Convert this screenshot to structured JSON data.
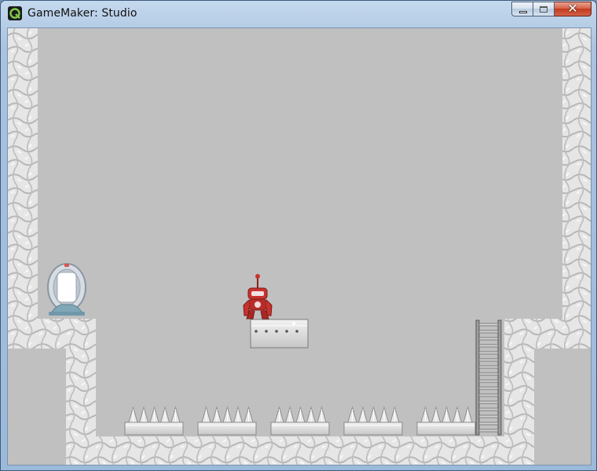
{
  "window": {
    "title": "GameMaker: Studio",
    "icon": "gamemaker-icon",
    "controls": [
      "minimize-icon",
      "maximize-icon",
      "close-icon"
    ]
  },
  "game": {
    "background_color": "#c0c0c0",
    "wall_color": "#e4e4e4",
    "player_color": "#c8322e",
    "spike_traps_count": 5
  }
}
